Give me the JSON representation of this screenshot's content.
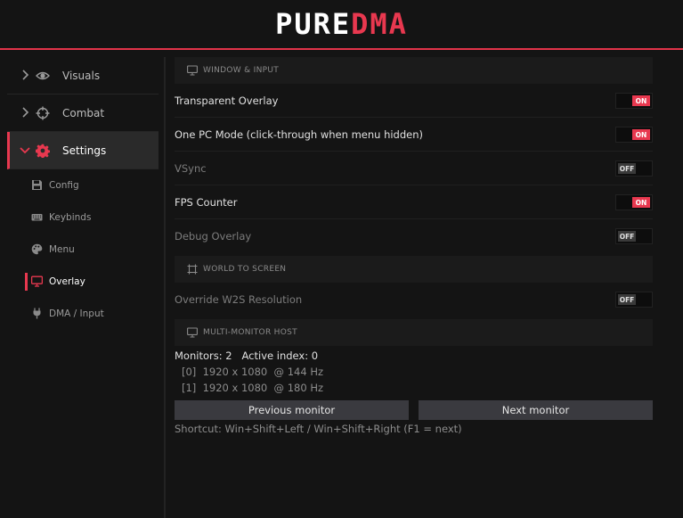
{
  "header": {
    "logo_part1": "PURE",
    "logo_part2": "DMA"
  },
  "colors": {
    "accent": "#e8384f",
    "background": "#141414",
    "panel": "#1b1b1b"
  },
  "sidebar": {
    "categories": [
      {
        "label": "Visuals",
        "icon": "eye-icon",
        "expanded": false
      },
      {
        "label": "Combat",
        "icon": "crosshair-icon",
        "expanded": false
      },
      {
        "label": "Settings",
        "icon": "gear-icon",
        "expanded": true
      }
    ],
    "settings_items": [
      {
        "label": "Config",
        "icon": "save-icon"
      },
      {
        "label": "Keybinds",
        "icon": "keyboard-icon"
      },
      {
        "label": "Menu",
        "icon": "palette-icon"
      },
      {
        "label": "Overlay",
        "icon": "monitor-icon",
        "active": true
      },
      {
        "label": "DMA / Input",
        "icon": "plug-icon"
      }
    ]
  },
  "main": {
    "window_input": {
      "title": "WINDOW & INPUT",
      "rows": [
        {
          "label": "Transparent Overlay",
          "state": "ON"
        },
        {
          "label": "One PC Mode (click-through when menu hidden)",
          "state": "ON"
        },
        {
          "label": "VSync",
          "state": "OFF"
        },
        {
          "label": "FPS Counter",
          "state": "ON"
        },
        {
          "label": "Debug Overlay",
          "state": "OFF"
        }
      ]
    },
    "world_to_screen": {
      "title": "WORLD TO SCREEN",
      "rows": [
        {
          "label": "Override W2S Resolution",
          "state": "OFF"
        }
      ]
    },
    "multi_monitor": {
      "title": "MULTI-MONITOR HOST",
      "summary": "Monitors: 2   Active index: 0",
      "monitors": [
        "[0]  1920 x 1080  @ 144 Hz",
        "[1]  1920 x 1080  @ 180 Hz"
      ],
      "prev_label": "Previous monitor",
      "next_label": "Next monitor",
      "shortcut": "Shortcut: Win+Shift+Left / Win+Shift+Right (F1 = next)"
    }
  }
}
